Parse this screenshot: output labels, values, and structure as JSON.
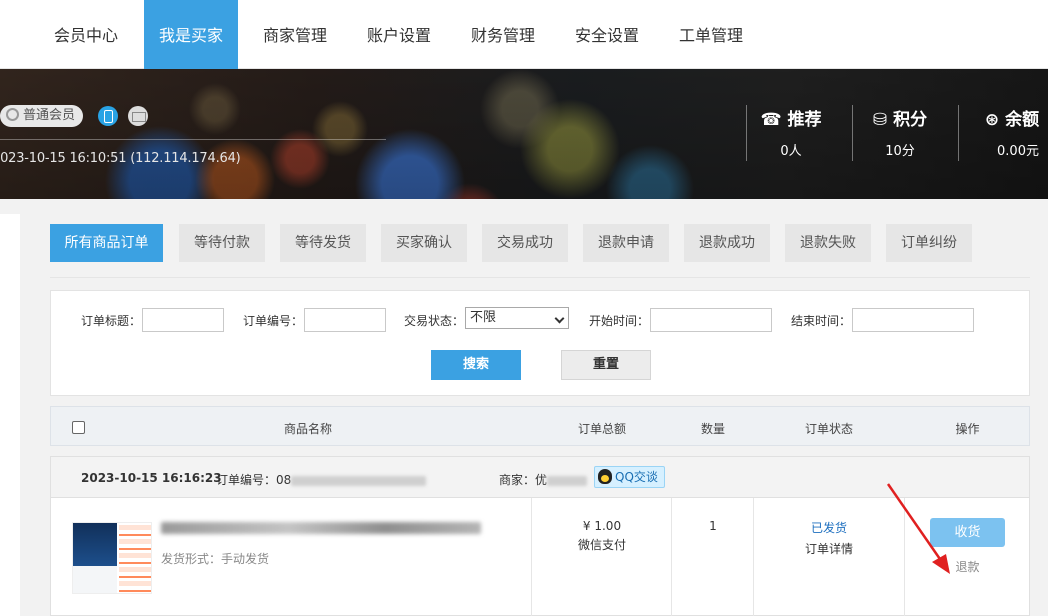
{
  "topnav": {
    "items": [
      {
        "label": "会员中心",
        "active": false
      },
      {
        "label": "我是买家",
        "active": true
      },
      {
        "label": "商家管理",
        "active": false
      },
      {
        "label": "账户设置",
        "active": false
      },
      {
        "label": "财务管理",
        "active": false
      },
      {
        "label": "安全设置",
        "active": false
      },
      {
        "label": "工单管理",
        "active": false
      }
    ]
  },
  "profile": {
    "member_level": "普通会员",
    "login_info": "2023-10-15 16:10:51 (112.114.174.64)"
  },
  "stats": [
    {
      "icon": "phone-icon",
      "label": "推荐",
      "value": "0人"
    },
    {
      "icon": "database-icon",
      "label": "积分",
      "value": "10分"
    },
    {
      "icon": "coin-icon",
      "label": "余额",
      "value": "0.00元"
    }
  ],
  "order_tabs": [
    {
      "label": "所有商品订单",
      "active": true
    },
    {
      "label": "等待付款",
      "active": false
    },
    {
      "label": "等待发货",
      "active": false
    },
    {
      "label": "买家确认",
      "active": false
    },
    {
      "label": "交易成功",
      "active": false
    },
    {
      "label": "退款申请",
      "active": false
    },
    {
      "label": "退款成功",
      "active": false
    },
    {
      "label": "退款失败",
      "active": false
    },
    {
      "label": "订单纠纷",
      "active": false
    }
  ],
  "filter": {
    "order_title_label": "订单标题：",
    "order_no_label": "订单编号：",
    "status_label": "交易状态：",
    "status_value": "不限",
    "start_label": "开始时间：",
    "end_label": "结束时间：",
    "search_button": "搜索",
    "reset_button": "重置"
  },
  "table": {
    "headers": [
      "商品名称",
      "订单总额",
      "数量",
      "订单状态",
      "操作"
    ]
  },
  "order": {
    "datetime": "2023-10-15 16:16:23",
    "order_no_label": "订单编号：08",
    "merchant_label": "商家：优",
    "qq_button": "QQ交谈",
    "ship_type": "发货形式：手动发货",
    "price": "¥ 1.00",
    "pay_method": "微信支付",
    "quantity": "1",
    "status": "已发货",
    "detail_link": "订单详情",
    "receive_button": "收货",
    "refund_link": "退款"
  },
  "colors": {
    "accent": "#3ba1e2",
    "receive_button": "#7cc2f0",
    "annotation_arrow": "#e02020"
  }
}
